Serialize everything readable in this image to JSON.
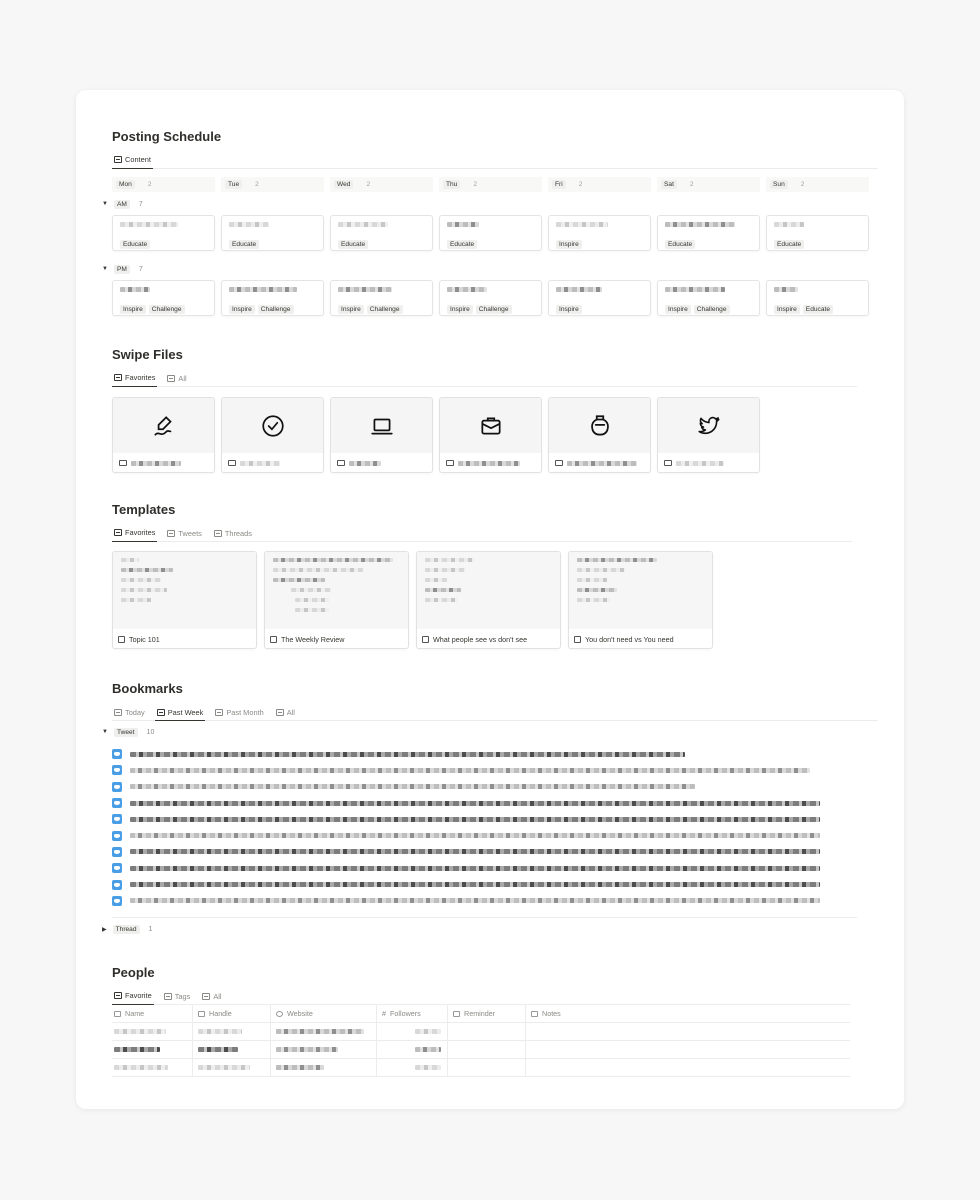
{
  "schedule": {
    "title": "Posting Schedule",
    "tab": "Content",
    "days": [
      {
        "label": "Mon",
        "count": "2"
      },
      {
        "label": "Tue",
        "count": "2"
      },
      {
        "label": "Wed",
        "count": "2"
      },
      {
        "label": "Thu",
        "count": "2"
      },
      {
        "label": "Fri",
        "count": "2"
      },
      {
        "label": "Sat",
        "count": "2"
      },
      {
        "label": "Sun",
        "count": "2"
      }
    ],
    "groups": [
      {
        "label": "AM",
        "count": "7",
        "tags": [
          [
            "Educate"
          ],
          [
            "Educate"
          ],
          [
            "Educate"
          ],
          [
            "Educate"
          ],
          [
            "Inspire"
          ],
          [
            "Educate"
          ],
          [
            "Educate"
          ]
        ]
      },
      {
        "label": "PM",
        "count": "7",
        "tags": [
          [
            "Inspire",
            "Challenge"
          ],
          [
            "Inspire",
            "Challenge"
          ],
          [
            "Inspire",
            "Challenge"
          ],
          [
            "Inspire",
            "Challenge"
          ],
          [
            "Inspire"
          ],
          [
            "Inspire",
            "Challenge"
          ],
          [
            "Inspire",
            "Educate"
          ]
        ]
      }
    ]
  },
  "swipe": {
    "title": "Swipe Files",
    "tabs": [
      "Favorites",
      "All"
    ],
    "icons": [
      "pen-icon",
      "check-circle-icon",
      "laptop-icon",
      "mail-bag-icon",
      "jar-icon",
      "twitter-icon"
    ]
  },
  "templates": {
    "title": "Templates",
    "tabs": [
      "Favorites",
      "Tweets",
      "Threads"
    ],
    "cards": [
      "Topic 101",
      "The Weekly Review",
      "What people see vs don't see",
      "You don't need vs You need"
    ]
  },
  "bookmarks": {
    "title": "Bookmarks",
    "tabs": [
      "Today",
      "Past Week",
      "Past Month",
      "All"
    ],
    "groups": [
      {
        "label": "Tweet",
        "count": "10"
      },
      {
        "label": "Thread",
        "count": "1"
      }
    ]
  },
  "people": {
    "title": "People",
    "tabs": [
      "Favorite",
      "Tags",
      "All"
    ],
    "columns": [
      "Name",
      "Handle",
      "Website",
      "Followers",
      "Reminder",
      "Notes"
    ]
  },
  "colors": {
    "accent": "#37352f",
    "twitter": "#4a9ee6"
  }
}
